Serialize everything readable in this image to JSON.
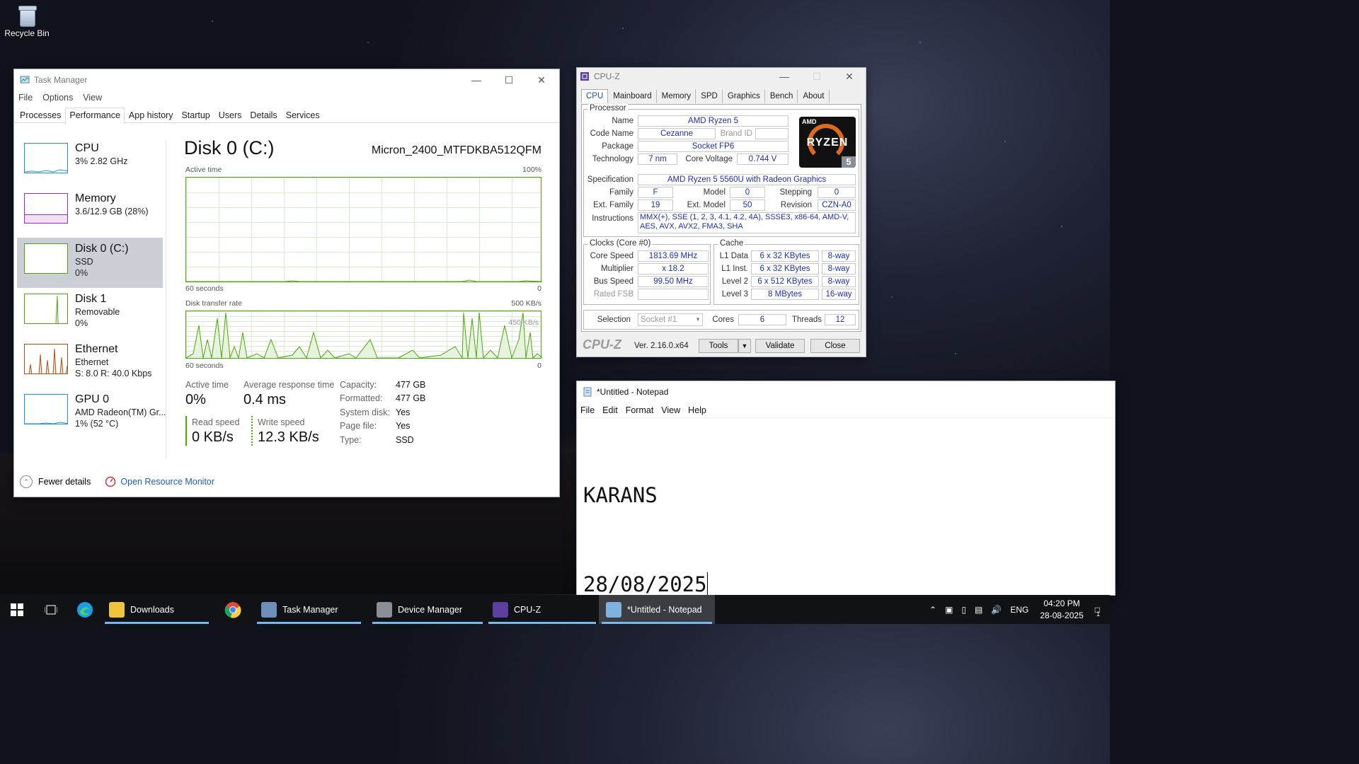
{
  "desktop": {
    "recycle_bin": "Recycle Bin"
  },
  "task_manager": {
    "title": "Task Manager",
    "menu": [
      "File",
      "Options",
      "View"
    ],
    "tabs": [
      "Processes",
      "Performance",
      "App history",
      "Startup",
      "Users",
      "Details",
      "Services"
    ],
    "active_tab": "Performance",
    "sidebar": [
      {
        "name": "CPU",
        "line1": "3% 2.82 GHz",
        "line2": "",
        "color": "#1e90d6"
      },
      {
        "name": "Memory",
        "line1": "3.6/12.9 GB (28%)",
        "line2": "",
        "color": "#9b30b2"
      },
      {
        "name": "Disk 0 (C:)",
        "line1": "SSD",
        "line2": "0%",
        "color": "#4da60c"
      },
      {
        "name": "Disk 1",
        "line1": "Removable",
        "line2": "0%",
        "color": "#4da60c"
      },
      {
        "name": "Ethernet",
        "line1": "Ethernet",
        "line2": "S: 8.0  R: 40.0 Kbps",
        "color": "#a5561f"
      },
      {
        "name": "GPU 0",
        "line1": "AMD Radeon(TM) Gr...",
        "line2": "1% (52 °C)",
        "color": "#1e90d6"
      }
    ],
    "main": {
      "title": "Disk 0 (C:)",
      "model": "Micron_2400_MTFDKBA512QFM",
      "graph1": {
        "label": "Active time",
        "max": "100%",
        "time": "60 seconds",
        "min": "0"
      },
      "graph2": {
        "label": "Disk transfer rate",
        "max": "500 KB/s",
        "inner": "450 KB/s",
        "time": "60 seconds",
        "min": "0"
      },
      "active_time_label": "Active time",
      "active_time_value": "0%",
      "avg_response_label": "Average response time",
      "avg_response_value": "0.4 ms",
      "read_label": "Read speed",
      "read_value": "0 KB/s",
      "write_label": "Write speed",
      "write_value": "12.3 KB/s",
      "props": [
        {
          "k": "Capacity:",
          "v": "477 GB"
        },
        {
          "k": "Formatted:",
          "v": "477 GB"
        },
        {
          "k": "System disk:",
          "v": "Yes"
        },
        {
          "k": "Page file:",
          "v": "Yes"
        },
        {
          "k": "Type:",
          "v": "SSD"
        }
      ]
    },
    "footer": {
      "fewer": "Fewer details",
      "resmon": "Open Resource Monitor"
    }
  },
  "cpuz": {
    "title": "CPU-Z",
    "tabs": [
      "CPU",
      "Mainboard",
      "Memory",
      "SPD",
      "Graphics",
      "Bench",
      "About"
    ],
    "processor_legend": "Processor",
    "name_label": "Name",
    "name": "AMD Ryzen 5",
    "codename_label": "Code Name",
    "codename": "Cezanne",
    "brandid_label": "Brand ID",
    "package_label": "Package",
    "package": "Socket FP6",
    "tech_label": "Technology",
    "tech": "7 nm",
    "corevolt_label": "Core Voltage",
    "corevolt": "0.744 V",
    "spec_label": "Specification",
    "spec": "AMD Ryzen 5 5560U with Radeon Graphics",
    "family_label": "Family",
    "family": "F",
    "model_label": "Model",
    "model": "0",
    "stepping_label": "Stepping",
    "stepping": "0",
    "extfamily_label": "Ext. Family",
    "extfamily": "19",
    "extmodel_label": "Ext. Model",
    "extmodel": "50",
    "revision_label": "Revision",
    "revision": "CZN-A0",
    "instr_label": "Instructions",
    "instr1": "MMX(+), SSE (1, 2, 3, 4.1, 4.2, 4A), SSSE3, x86-64, AMD-V,",
    "instr2": "AES, AVX, AVX2, FMA3, SHA",
    "clocks_legend": "Clocks (Core #0)",
    "corespeed_label": "Core Speed",
    "corespeed": "1813.69 MHz",
    "mult_label": "Multiplier",
    "mult": "x 18.2",
    "bus_label": "Bus Speed",
    "bus": "99.50 MHz",
    "fsb_label": "Rated FSB",
    "cache_legend": "Cache",
    "cache": [
      {
        "label": "L1 Data",
        "size": "6 x 32 KBytes",
        "way": "8-way"
      },
      {
        "label": "L1 Inst.",
        "size": "6 x 32 KBytes",
        "way": "8-way"
      },
      {
        "label": "Level 2",
        "size": "6 x 512 KBytes",
        "way": "8-way"
      },
      {
        "label": "Level 3",
        "size": "8 MBytes",
        "way": "16-way"
      }
    ],
    "selection_label": "Selection",
    "selection": "Socket #1",
    "cores_label": "Cores",
    "cores": "6",
    "threads_label": "Threads",
    "threads": "12",
    "logo_text": "CPU-Z",
    "version": "Ver. 2.16.0.x64",
    "tools": "Tools",
    "validate": "Validate",
    "close": "Close",
    "badge_brand": "AMD",
    "badge_name": "RYZEN",
    "badge_num": "5"
  },
  "notepad": {
    "title": "*Untitled - Notepad",
    "menu": [
      "File",
      "Edit",
      "Format",
      "View",
      "Help"
    ],
    "line1": "KARANS",
    "line2": "28/08/2025"
  },
  "taskbar": {
    "apps": [
      {
        "label": "Downloads",
        "color": "#f0c33c"
      },
      {
        "label": "Task Manager",
        "color": "#6d8fb8"
      },
      {
        "label": "Device Manager",
        "color": "#8a8f96"
      },
      {
        "label": "CPU-Z",
        "color": "#5b3fa0"
      },
      {
        "label": "*Untitled - Notepad",
        "color": "#7fb3de"
      }
    ],
    "lang": "ENG",
    "time": "04:20 PM",
    "date": "28-08-2025",
    "notif_count": "1"
  }
}
